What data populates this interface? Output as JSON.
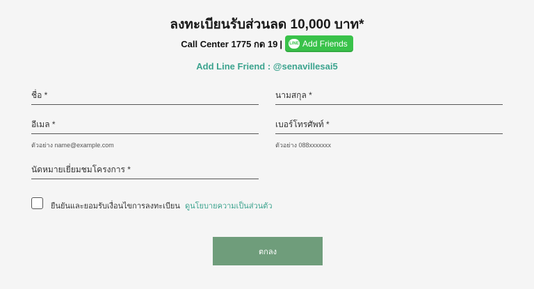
{
  "header": {
    "title": "ลงทะเบียนรับส่วนลด 10,000 บาท*",
    "call_center": "Call Center 1775 กด 19",
    "separator": "|",
    "line_logo_text": "LINE",
    "line_button_label": "Add Friends",
    "add_line_friend": "Add Line Friend : @senavillesai5"
  },
  "form": {
    "first_name_label": "ชื่อ *",
    "last_name_label": "นามสกุล *",
    "email_label": "อีเมล *",
    "email_hint": "ตัวอย่าง name@example.com",
    "phone_label": "เบอร์โทรศัพท์ *",
    "phone_hint": "ตัวอย่าง 088xxxxxxx",
    "appointment_label": "นัดหมายเยี่ยมชมโครงการ *",
    "consent_text": "ยืนยันและยอมรับเงื่อนไขการลงทะเบียน",
    "privacy_link": "ดูนโยบายความเป็นส่วนตัว",
    "consent_checked": false,
    "submit_label": "ตกลง"
  },
  "colors": {
    "background": "#f5f5f5",
    "accent_teal": "#3ba38e",
    "line_green": "#39c24a",
    "submit_green": "#6f9d7b"
  },
  "icons": {
    "line_logo": "line-logo-icon",
    "checkbox": "checkbox-unchecked-icon"
  }
}
